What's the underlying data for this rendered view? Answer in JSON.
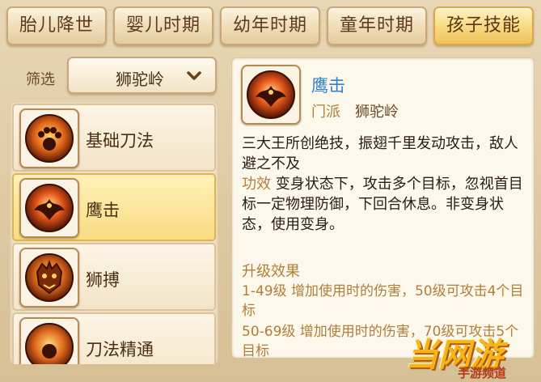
{
  "tabs": [
    {
      "label": "胎儿降世",
      "active": false
    },
    {
      "label": "婴儿时期",
      "active": false
    },
    {
      "label": "幼年时期",
      "active": false
    },
    {
      "label": "童年时期",
      "active": false
    },
    {
      "label": "孩子技能",
      "active": true
    }
  ],
  "filter": {
    "label": "筛选",
    "selected": "狮驼岭"
  },
  "skills": [
    {
      "name": "基础刀法",
      "icon": "paw-orb-icon",
      "active": false
    },
    {
      "name": "鹰击",
      "icon": "eagle-strike-icon",
      "active": true
    },
    {
      "name": "狮搏",
      "icon": "lion-head-icon",
      "active": false
    },
    {
      "name": "刀法精通",
      "icon": "blade-orb-icon",
      "active": false
    }
  ],
  "detail": {
    "title": "鹰击",
    "faction_label": "门派",
    "faction_value": "狮驼岭",
    "description": "三大王所创绝技，振翅千里发动攻击，敌人避之不及",
    "effect_label": "功效",
    "effect_text": "变身状态下，攻击多个目标，忽视首目标一定物理防御，下回合休息。非变身状态，使用变身。",
    "upgrade_title": "升级效果",
    "upgrades": [
      "1-49级 增加使用时的伤害，50级可攻击4个目标",
      "50-69级 增加使用时的伤害，70级可攻击5个目标"
    ]
  },
  "watermark": {
    "main": "当网游",
    "sub": "手游频道"
  },
  "colors": {
    "accent_blue": "#2d7fcf",
    "label_brown": "#b07e3c",
    "active_tab": "#f7d880"
  }
}
